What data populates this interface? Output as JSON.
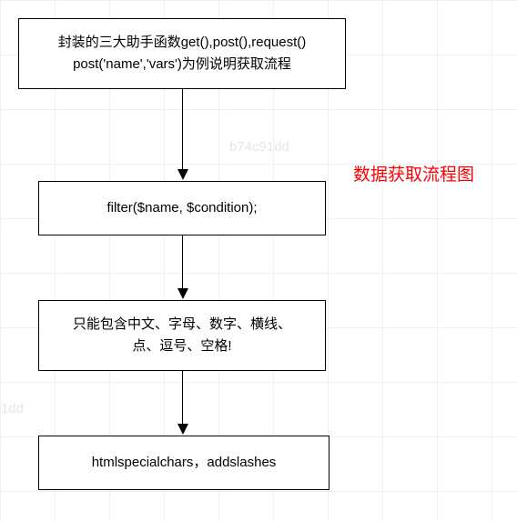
{
  "diagram": {
    "title": "数据获取流程图",
    "nodes": {
      "n1_line1": "封装的三大助手函数get(),post(),request()",
      "n1_line2": "post('name','vars')为例说明获取流程",
      "n2": "filter($name, $condition);",
      "n3_line1": "只能包含中文、字母、数字、横线、",
      "n3_line2": "点、逗号、空格!",
      "n4": "htmlspecialchars，addslashes"
    },
    "watermark": "b74c91dd"
  }
}
